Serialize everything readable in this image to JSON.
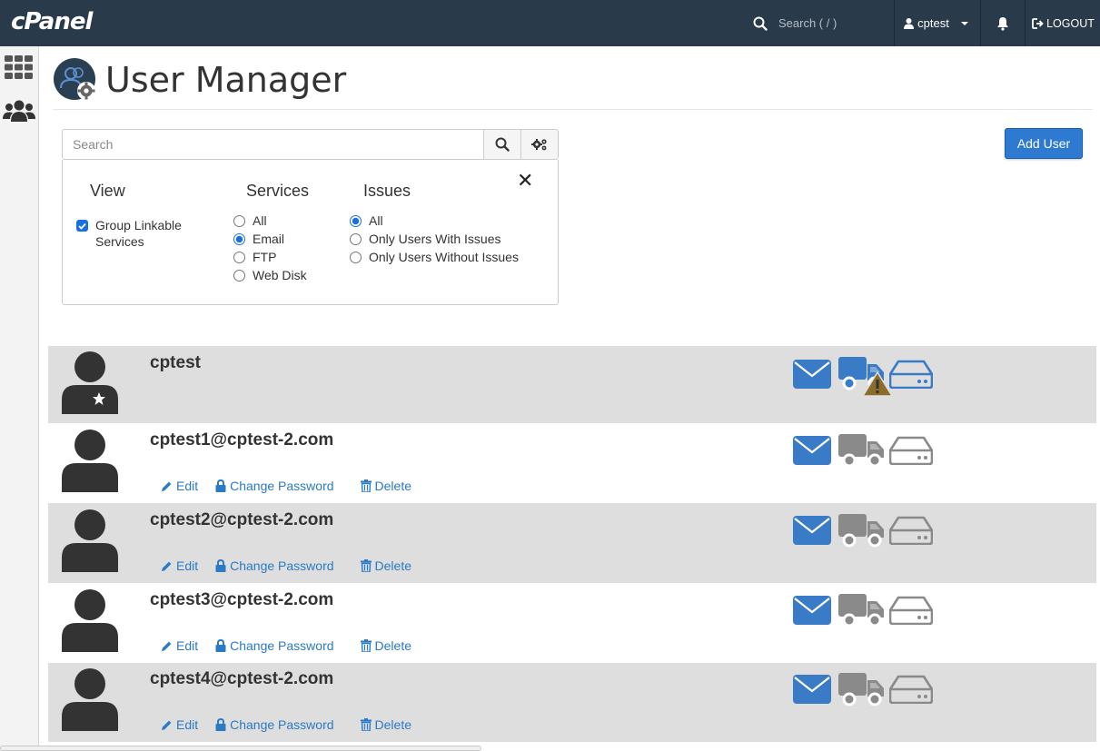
{
  "topbar": {
    "logo": "cPanel",
    "search_label": "Search ( / )",
    "username": "cptest",
    "logout": "LOGOUT"
  },
  "page": {
    "title": "User Manager"
  },
  "search": {
    "placeholder": "Search"
  },
  "add_user_label": "Add User",
  "filter": {
    "view": {
      "heading": "View",
      "option": "Group Linkable Services",
      "checked": true
    },
    "services": {
      "heading": "Services",
      "options": [
        "All",
        "Email",
        "FTP",
        "Web Disk"
      ],
      "selected": "Email"
    },
    "issues": {
      "heading": "Issues",
      "options": [
        "All",
        "Only Users With Issues",
        "Only Users Without Issues"
      ],
      "selected": "All"
    }
  },
  "actions": {
    "edit": "Edit",
    "change_password": "Change Password",
    "delete": "Delete"
  },
  "users": [
    {
      "name": "cptest",
      "is_main_account": true,
      "email_service": "enabled",
      "ftp_service": "enabled-warning",
      "webdisk_service": "enabled"
    },
    {
      "name": "cptest1@cptest-2.com",
      "email_service": "enabled",
      "ftp_service": "disabled",
      "webdisk_service": "disabled"
    },
    {
      "name": "cptest2@cptest-2.com",
      "email_service": "enabled",
      "ftp_service": "disabled",
      "webdisk_service": "disabled"
    },
    {
      "name": "cptest3@cptest-2.com",
      "email_service": "enabled",
      "ftp_service": "disabled",
      "webdisk_service": "disabled"
    },
    {
      "name": "cptest4@cptest-2.com",
      "email_service": "enabled",
      "ftp_service": "disabled",
      "webdisk_service": "disabled"
    }
  ],
  "colors": {
    "topbar": "#293a4a",
    "link": "#2a7ac5",
    "service_on": "#3a7bc8",
    "service_off": "#8a8a8a",
    "warning": "#8a6d2a",
    "primary_button": "#2e7ad1"
  }
}
